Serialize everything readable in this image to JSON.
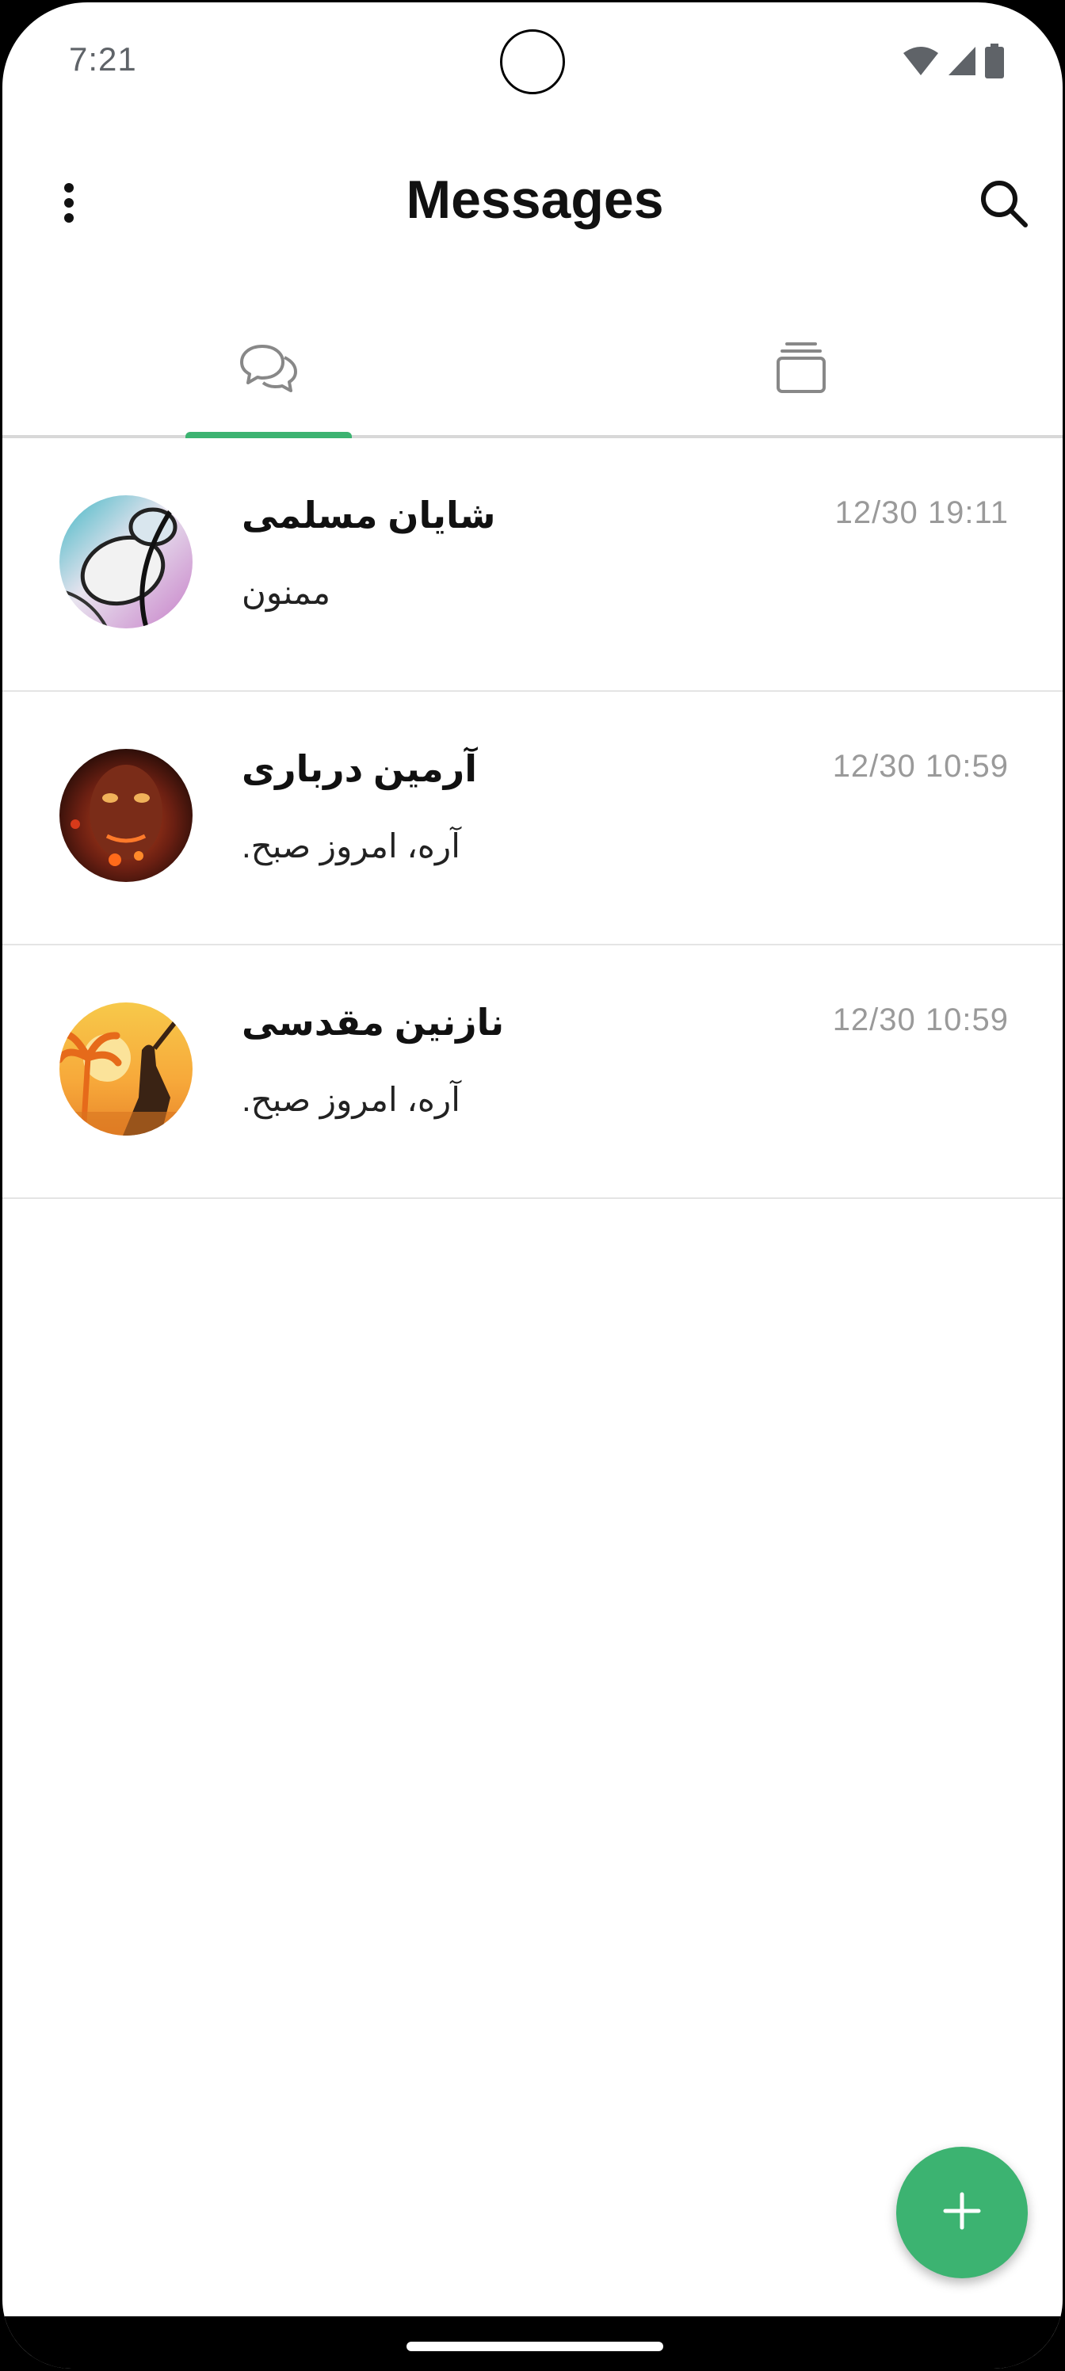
{
  "status_bar": {
    "time": "7:21",
    "icons": [
      "wifi-icon",
      "cell-signal-icon",
      "battery-icon"
    ]
  },
  "header": {
    "title": "Messages",
    "menu_icon": "more-vert-icon",
    "search_icon": "search-icon"
  },
  "tabs": [
    {
      "icon": "chat-bubbles-icon",
      "selected": true
    },
    {
      "icon": "stacked-cards-icon",
      "selected": false
    }
  ],
  "conversations": [
    {
      "name": "شایان مسلمی",
      "preview": "ممنون",
      "time": "12/30 19:11",
      "avatar": "abstract-avatar"
    },
    {
      "name": "آرمین درباری",
      "preview": "آره، امروز صبح.",
      "time": "12/30 10:59",
      "avatar": "fire-face-avatar"
    },
    {
      "name": "نازنین مقدسی",
      "preview": "آره، امروز صبح.",
      "time": "12/30 10:59",
      "avatar": "sunset-palm-avatar"
    }
  ],
  "fab": {
    "icon": "plus-icon"
  },
  "colors": {
    "accent": "#3cb371",
    "text": "#111111",
    "muted": "#9a9a9a",
    "divider": "#e4e4e4"
  }
}
